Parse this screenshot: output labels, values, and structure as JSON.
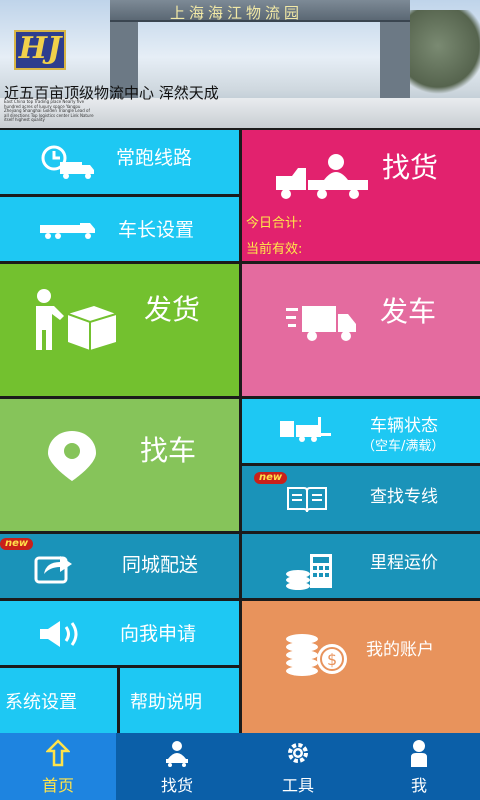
{
  "banner": {
    "gate_text": "上海海江物流园",
    "logo_text": "HJ",
    "slogan": "近五百亩顶级物流中心  浑然天成",
    "fine_print": "East China top Trading place Nearly five hundred acres of luxury space Yangpu Zhejiang Shanghai Golden Triangle Lead of all directions Top logistics center Link Nature itself highest quality"
  },
  "tiles": {
    "regular_route": "常跑线路",
    "find_goods": "找货",
    "captain_settings": "车长设置",
    "today_total": "今日合计:",
    "currently_valid": "当前有效:",
    "ship_goods": "发货",
    "depart": "发车",
    "find_truck": "找车",
    "vehicle_status": "车辆状态",
    "vehicle_status_sub": "（空车/满载）",
    "find_special_line": "查找专线",
    "new_badge": "new",
    "city_delivery": "同城配送",
    "mileage_freight": "里程运价",
    "apply_to_me": "向我申请",
    "my_account": "我的账户",
    "system_settings": "系统设置",
    "help": "帮助说明"
  },
  "nav": {
    "home": "首页",
    "find_goods": "找货",
    "tools": "工具",
    "me": "我"
  },
  "colors": {
    "cyan": "#1ec8f3",
    "magenta": "#e2226e",
    "green": "#73c12f",
    "pink": "#e46b9f",
    "teal": "#1a93b9",
    "orange": "#e8935c",
    "nav_bg": "#0b5fa8",
    "nav_active": "#1e84e0"
  }
}
